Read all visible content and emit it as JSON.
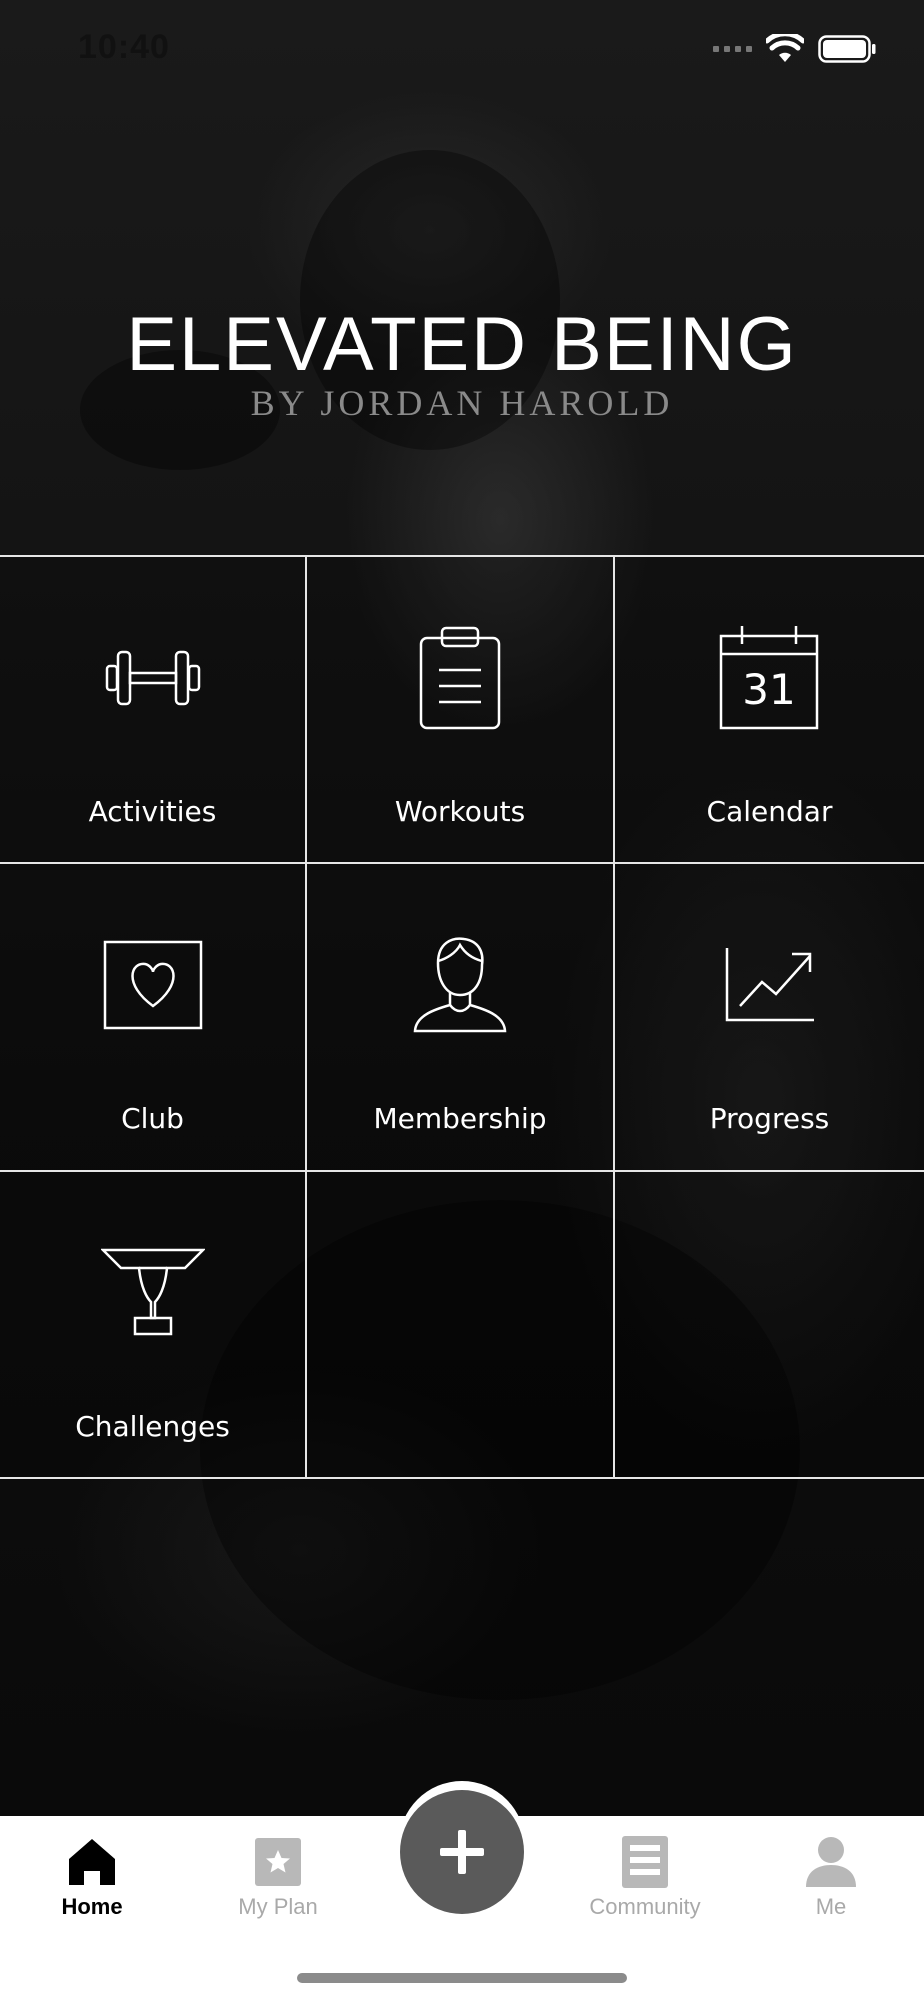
{
  "status_bar": {
    "time": "10:40"
  },
  "brand": {
    "title": "ELEVATED BEING",
    "subtitle": "BY JORDAN HAROLD"
  },
  "grid": {
    "tiles": [
      {
        "label": "Activities",
        "icon": "dumbbell-icon"
      },
      {
        "label": "Workouts",
        "icon": "clipboard-icon"
      },
      {
        "label": "Calendar",
        "icon": "calendar-icon",
        "icon_text": "31"
      },
      {
        "label": "Club",
        "icon": "heart-box-icon"
      },
      {
        "label": "Membership",
        "icon": "person-icon"
      },
      {
        "label": "Progress",
        "icon": "chart-trend-icon"
      },
      {
        "label": "Challenges",
        "icon": "trophy-icon"
      },
      {
        "label": "",
        "icon": ""
      },
      {
        "label": "",
        "icon": ""
      }
    ]
  },
  "tab_bar": {
    "items": [
      {
        "label": "Home",
        "icon": "home-icon",
        "active": true
      },
      {
        "label": "My Plan",
        "icon": "star-square-icon",
        "active": false
      },
      {
        "label": "Community",
        "icon": "document-icon",
        "active": false
      },
      {
        "label": "Me",
        "icon": "user-icon",
        "active": false
      }
    ],
    "fab_icon": "plus-icon"
  },
  "colors": {
    "grid_line": "#e6e6e6",
    "tab_active": "#000000",
    "tab_inactive": "#a9a9a9",
    "fab": "#5a5a5a"
  }
}
